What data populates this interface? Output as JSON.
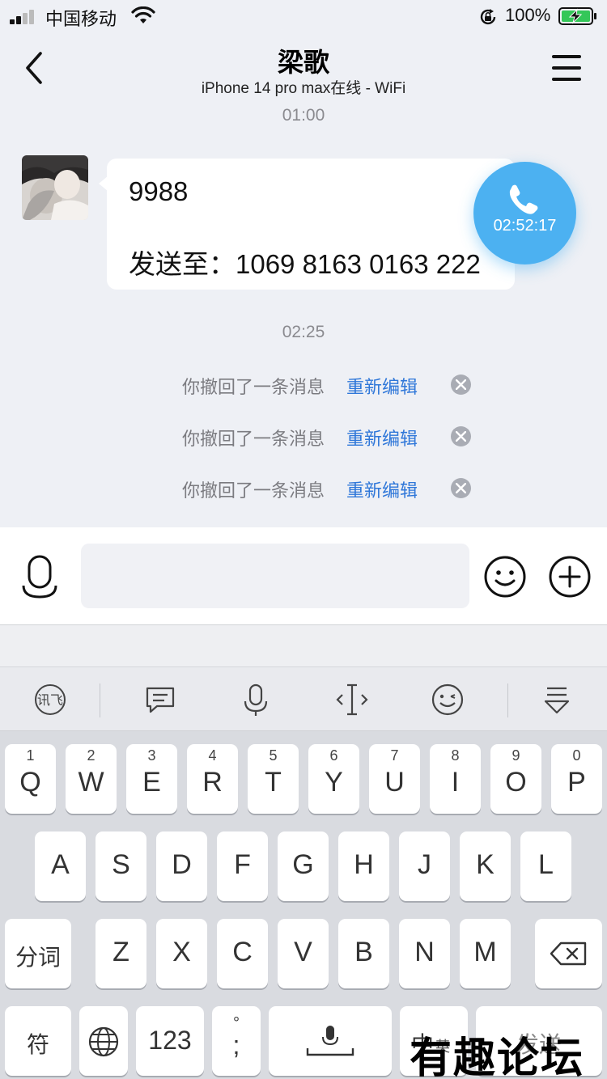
{
  "status_bar": {
    "carrier": "中国移动",
    "battery_percent": "100%",
    "battery_level": 1.0,
    "signal_bars": 2,
    "colors": {
      "battery_fill": "#34c759"
    }
  },
  "nav": {
    "back_icon": "chevron-left-icon",
    "title": "梁歌",
    "subtitle": "iPhone 14 pro max在线 - WiFi",
    "menu_icon": "hamburger-menu-icon"
  },
  "chat": {
    "time_1": "01:00",
    "message": {
      "line_1": "9988",
      "line_2": "发送至：1069 8163 0163 222"
    },
    "call": {
      "icon": "phone-icon",
      "timer": "02:52:17",
      "color": "#4cb1f1"
    },
    "time_2": "02:25",
    "recalls": [
      {
        "text": "你撤回了一条消息",
        "action": "重新编辑"
      },
      {
        "text": "你撤回了一条消息",
        "action": "重新编辑"
      },
      {
        "text": "你撤回了一条消息",
        "action": "重新编辑"
      }
    ],
    "link_color": "#2f77d9"
  },
  "input_bar": {
    "placeholder": "",
    "voice_icon": "microphone-icon",
    "emoji_icon": "smiley-icon",
    "plus_icon": "plus-circle-icon"
  },
  "keyboard": {
    "toolbar_icons": [
      "iflytek-logo-icon",
      "message-icon",
      "microphone-icon",
      "cursor-icon",
      "wink-emoji-icon",
      "collapse-keyboard-icon"
    ],
    "row1": [
      {
        "num": "1",
        "ch": "Q"
      },
      {
        "num": "2",
        "ch": "W"
      },
      {
        "num": "3",
        "ch": "E"
      },
      {
        "num": "4",
        "ch": "R"
      },
      {
        "num": "5",
        "ch": "T"
      },
      {
        "num": "6",
        "ch": "Y"
      },
      {
        "num": "7",
        "ch": "U"
      },
      {
        "num": "8",
        "ch": "I"
      },
      {
        "num": "9",
        "ch": "O"
      },
      {
        "num": "0",
        "ch": "P"
      }
    ],
    "row2": [
      "A",
      "S",
      "D",
      "F",
      "G",
      "H",
      "J",
      "K",
      "L"
    ],
    "row3": [
      "Z",
      "X",
      "C",
      "V",
      "B",
      "N",
      "M"
    ],
    "fenci": "分词",
    "fu": "符",
    "num_key": "123",
    "semicolon_top": "°",
    "semicolon": ";",
    "lang_main": "中",
    "lang_sub": "英",
    "send": "发送"
  },
  "watermark": "有趣论坛"
}
